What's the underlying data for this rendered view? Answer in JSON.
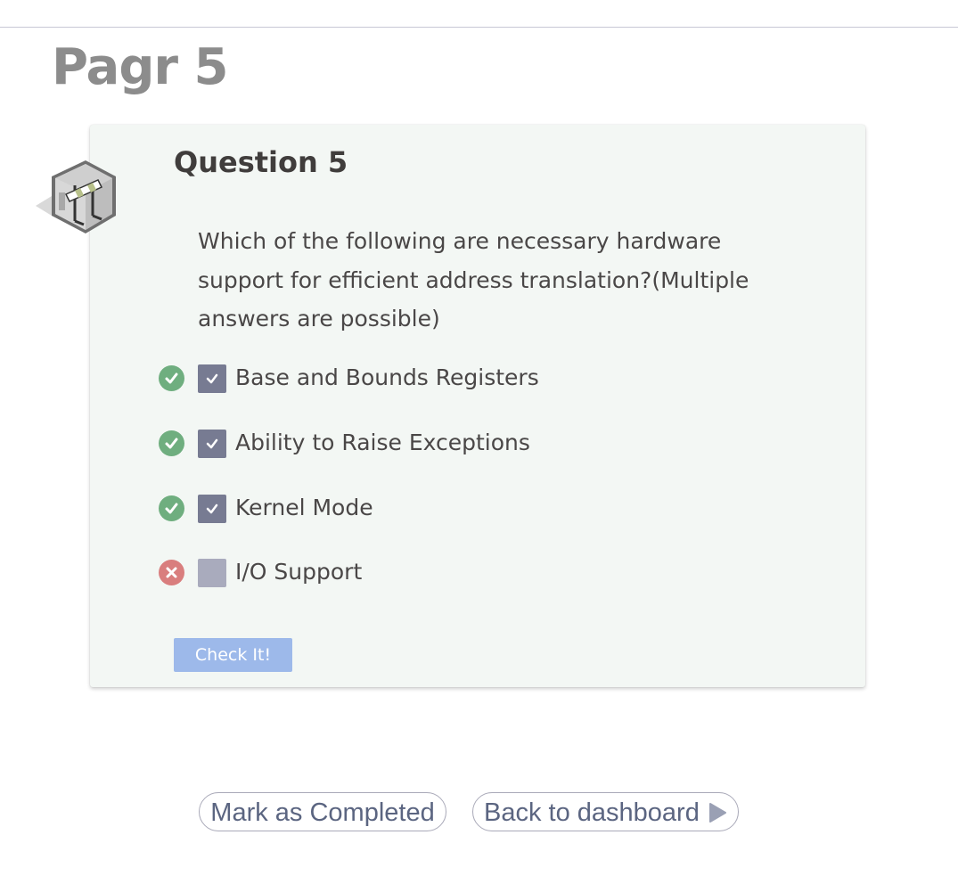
{
  "page": {
    "title": "Pagr 5"
  },
  "question": {
    "title": "Question 5",
    "text": "Which of the following are necessary hardware support for efficient address translation?(Multiple answers are possible)",
    "options": [
      {
        "label": "Base and Bounds Registers",
        "checked": true,
        "result": "correct"
      },
      {
        "label": "Ability to Raise Exceptions",
        "checked": true,
        "result": "correct"
      },
      {
        "label": "Kernel Mode",
        "checked": true,
        "result": "correct"
      },
      {
        "label": "I/O Support",
        "checked": false,
        "result": "incorrect"
      }
    ],
    "check_button": "Check It!"
  },
  "footer": {
    "mark_completed": "Mark as Completed",
    "back_dashboard": "Back to dashboard"
  },
  "colors": {
    "correct": "#6fae7f",
    "incorrect": "#d97e7e",
    "checkbox_checked": "#777b92",
    "checkbox_unchecked": "#a9abbd",
    "button": "#9db9ea",
    "pill_text": "#5b6581"
  },
  "icons": {
    "badge": "barrier-cube-icon",
    "correct": "check-circle-icon",
    "incorrect": "x-circle-icon",
    "arrow": "play-arrow-icon"
  }
}
